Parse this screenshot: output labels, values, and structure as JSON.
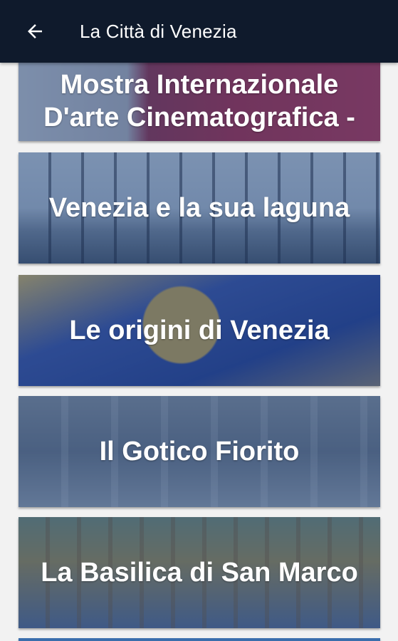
{
  "app_bar": {
    "title": "La Città di Venezia",
    "back_icon": "arrow-left-icon"
  },
  "cards": [
    {
      "label": "Mostra Internazionale D'arte Cinematografica -"
    },
    {
      "label": "Venezia e la sua laguna"
    },
    {
      "label": "Le origini di Venezia"
    },
    {
      "label": "Il Gotico Fiorito"
    },
    {
      "label": "La Basilica di San Marco"
    }
  ],
  "colors": {
    "app_bar_bg": "#0f1a2c",
    "card_overlay": "#1e4682",
    "background": "#f2f2f2"
  }
}
